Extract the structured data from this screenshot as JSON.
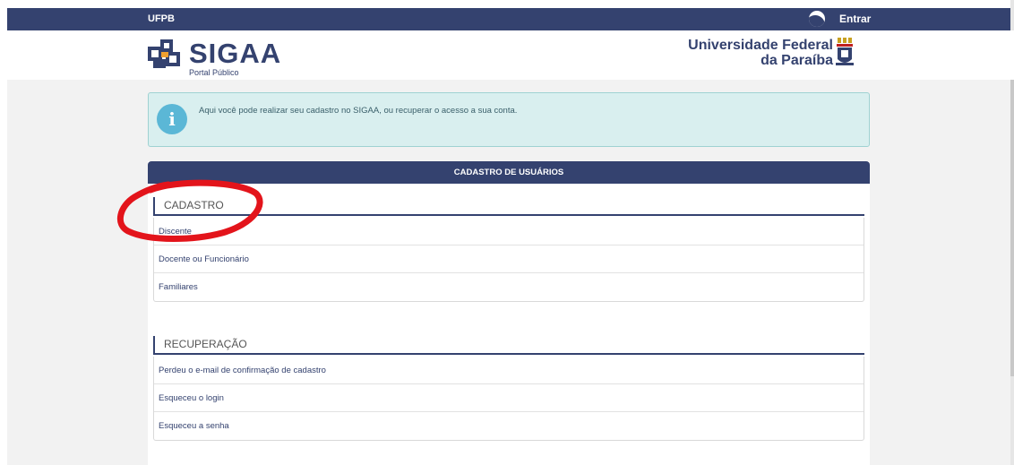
{
  "topbar": {
    "brand": "UFPB",
    "login_label": "Entrar",
    "icon": "moon-icon"
  },
  "header": {
    "logo_title": "SIGAA",
    "logo_subtitle": "Portal Público",
    "university_line1": "Universidade Federal",
    "university_line2": "da Paraíba"
  },
  "alert": {
    "icon": "info-icon",
    "message": "Aqui você pode realizar seu cadastro no SIGAA, ou recuperar o acesso a sua conta."
  },
  "panel": {
    "title": "CADASTRO DE USUÁRIOS",
    "sections": [
      {
        "title": "CADASTRO",
        "items": [
          {
            "label": "Discente"
          },
          {
            "label": "Docente ou Funcionário"
          },
          {
            "label": "Familiares"
          }
        ]
      },
      {
        "title": "RECUPERAÇÃO",
        "items": [
          {
            "label": "Perdeu o e-mail de confirmação de cadastro"
          },
          {
            "label": "Esqueceu o login"
          },
          {
            "label": "Esqueceu a senha"
          }
        ]
      }
    ]
  },
  "colors": {
    "primary": "#34426f",
    "alert_bg": "#d9efef",
    "annotation": "#e3141b"
  }
}
